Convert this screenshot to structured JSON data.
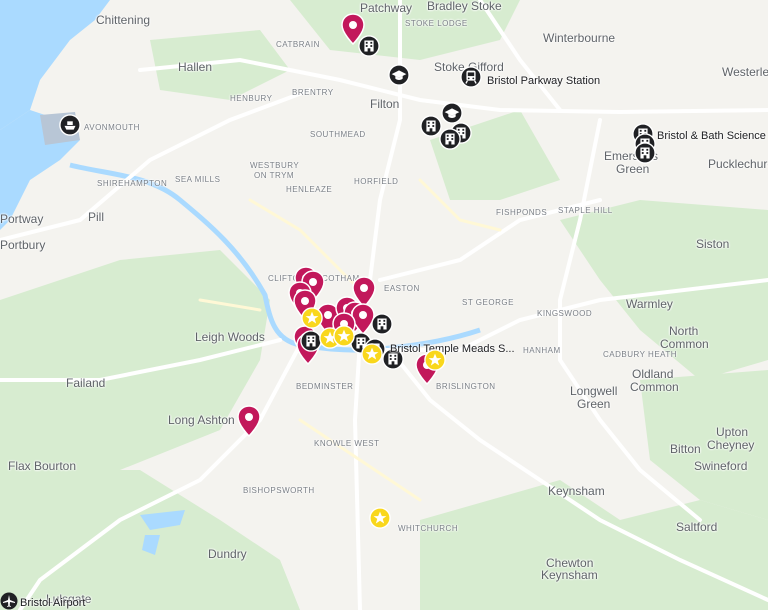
{
  "places": {
    "large": [
      "Patchway",
      "Bradley Stoke",
      "Chittening",
      "Winterbourne",
      "Hallen",
      "Westerleigh",
      "Stoke Gifford",
      "Filton",
      "Emersons",
      "Green",
      "Pucklechurch",
      "Pill",
      "Avonmouth",
      "Portbury",
      "Easton",
      "Warmley",
      "Leigh Woods",
      "North",
      "Common",
      "Failand",
      "Oldland",
      "Common",
      "Longwell",
      "Green",
      "Long Ashton",
      "Upton",
      "Cheyney",
      "Bitton",
      "Swineford",
      "Flax Bourton",
      "Keynsham",
      "Saltford",
      "Chewton",
      "Keynsham",
      "Dundry",
      "Lulsgate",
      "Siston",
      "Clifton",
      "Cotham",
      "Portway"
    ],
    "small": [
      "STOKE LODGE",
      "CATBRAIN",
      "HENBURY",
      "BRENTRY",
      "SOUTHMEAD",
      "WESTBURY",
      "ON TRYM",
      "SHIREHAMPTON",
      "SEA MILLS",
      "HENLEAZE",
      "HORFIELD",
      "FISHPONDS",
      "STAPLE HILL",
      "ST GEORGE",
      "KINGSWOOD",
      "HANHAM",
      "CADBURY HEATH",
      "BEDMINSTER",
      "BRISLINGTON",
      "KNOWLE WEST",
      "BISHOPSWORTH",
      "WHITCHURCH"
    ]
  },
  "pois": {
    "parkway": "Bristol Parkway Station",
    "science": "Bristol & Bath Science ...",
    "temple": "Bristol Temple Meads S...",
    "airport": "Bristol Airport"
  },
  "icons": {
    "red_pin": "location-pin-icon",
    "building": "building-icon",
    "star": "star-icon",
    "school": "school-icon",
    "train": "train-icon",
    "ferry": "ferry-icon",
    "airport": "airplane-icon"
  },
  "colors": {
    "water": "#aadaff",
    "land": "#f4f3ef",
    "green": "#d7ecd0",
    "road": "#ffffff",
    "pin": "#c2185b",
    "star": "#f9d71c",
    "marker": "#202124"
  }
}
